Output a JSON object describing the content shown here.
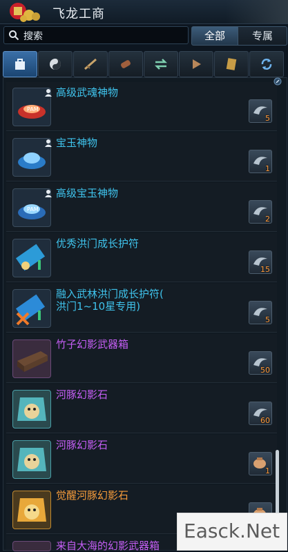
{
  "window": {
    "title": "飞龙工商"
  },
  "search": {
    "placeholder": "搜索",
    "icon": "search-icon"
  },
  "filters": [
    {
      "label": "全部",
      "selected": true
    },
    {
      "label": "专属",
      "selected": false
    }
  ],
  "tabs": [
    {
      "icon": "bag-icon",
      "active": true
    },
    {
      "icon": "yin-yang-icon",
      "active": false
    },
    {
      "icon": "weapon-icon",
      "active": false
    },
    {
      "icon": "scroll-icon",
      "active": false
    },
    {
      "icon": "exchange-icon",
      "active": false
    },
    {
      "icon": "play-icon",
      "active": false
    },
    {
      "icon": "document-icon",
      "active": false
    },
    {
      "icon": "refresh-icon",
      "active": false
    }
  ],
  "items": [
    {
      "name": "高级武魂神物",
      "color": "cyan",
      "personal": true,
      "price": "5",
      "icon": "red-orb-icon"
    },
    {
      "name": "宝玉神物",
      "color": "cyan",
      "personal": true,
      "price": "1",
      "icon": "blue-orb-icon"
    },
    {
      "name": "高级宝玉神物",
      "color": "cyan",
      "personal": true,
      "price": "2",
      "icon": "blue-orb-icon"
    },
    {
      "name": "优秀洪门成长护符",
      "color": "cyan",
      "personal": false,
      "price": "15",
      "icon": "talisman-icon"
    },
    {
      "name": "融入武林洪门成长护符(\n洪门1~10星专用)",
      "color": "cyan",
      "personal": false,
      "price": "5",
      "icon": "talisman-icon"
    },
    {
      "name": "竹子幻影武器箱",
      "color": "purple",
      "personal": false,
      "price": "50",
      "icon": "weapon-box-icon"
    },
    {
      "name": "河豚幻影石",
      "color": "purple",
      "personal": false,
      "price": "60",
      "icon": "puffer-stone-icon"
    },
    {
      "name": "河豚幻影石",
      "color": "purple",
      "personal": false,
      "price": "1",
      "icon": "puffer-stone-icon"
    },
    {
      "name": "觉醒河豚幻影石",
      "color": "orange",
      "personal": false,
      "price": "2",
      "icon": "gold-stone-icon"
    },
    {
      "name": "来自大海的幻影武器箱",
      "color": "purple",
      "personal": false,
      "price": "",
      "icon": "weapon-box-icon"
    }
  ],
  "watermark": "Easck.Net"
}
